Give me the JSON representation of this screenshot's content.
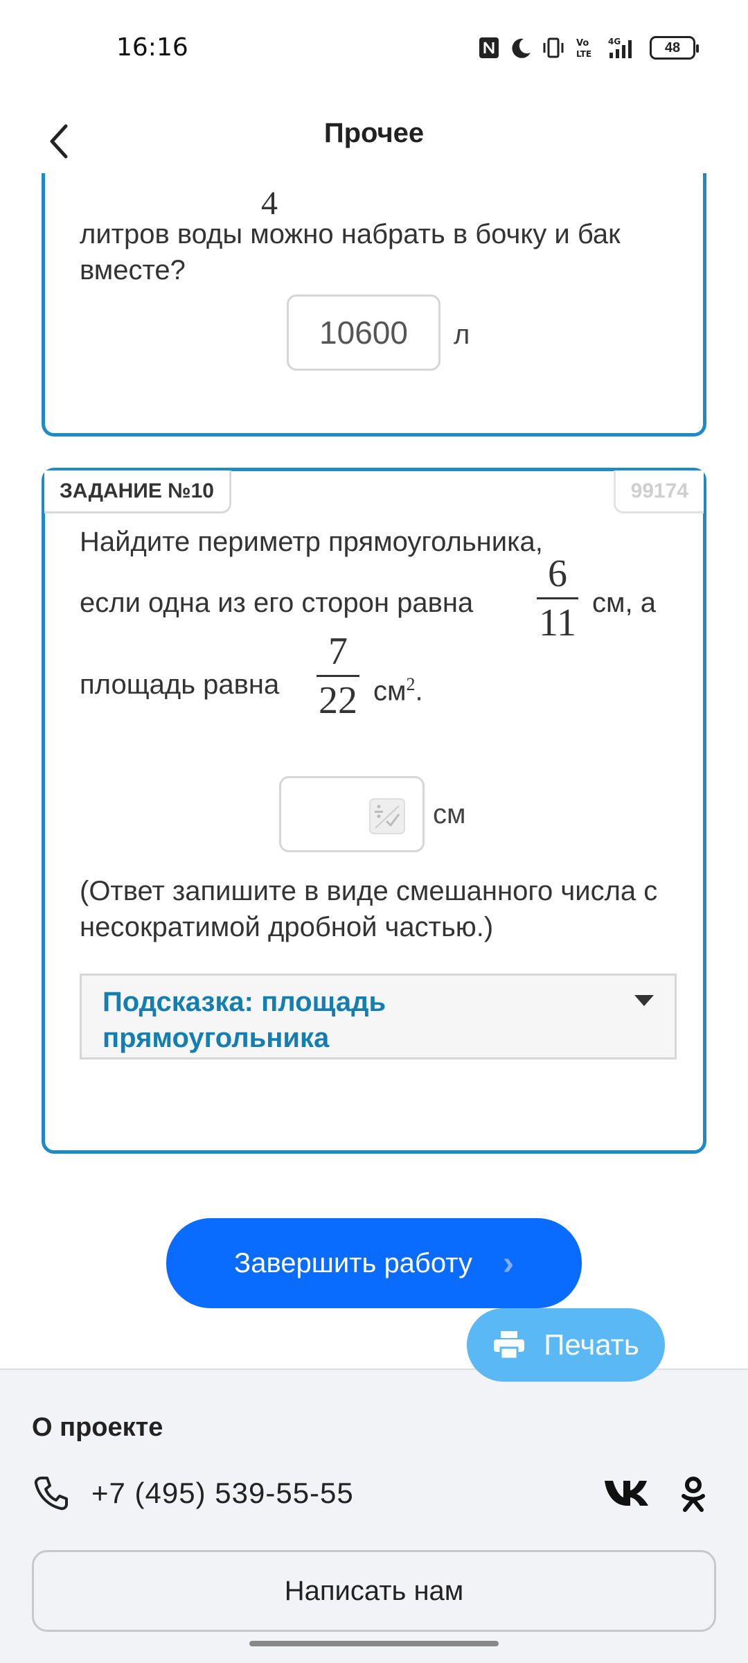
{
  "status_bar": {
    "time": "16:16",
    "battery": "48",
    "icons": [
      "nfc-icon",
      "moon-icon",
      "vibrate-icon",
      "volte-icon",
      "signal-4g-icon",
      "battery-icon"
    ]
  },
  "header": {
    "title": "Прочее",
    "back_icon": "chevron-left-icon"
  },
  "prev_task": {
    "fraction_denominator": "4",
    "text": "литров воды можно набрать в бочку и бак вместе?",
    "answer_value": "10600",
    "unit": "л"
  },
  "task10": {
    "label": "ЗАДАНИЕ №10",
    "id": "99174",
    "line1": "Найдите периметр прямоугольника,",
    "line2_text": "если одна из его сторон равна",
    "frac1": {
      "num": "6",
      "den": "11"
    },
    "line2_suffix": "см, а",
    "line3_text": "площадь равна",
    "frac2": {
      "num": "7",
      "den": "22"
    },
    "line3_suffix": "см",
    "line3_sup": "2",
    "line3_end": ".",
    "answer_value": "",
    "answer_icon": "fraction-input-icon",
    "answer_unit": "см",
    "note": "(Ответ запишите в виде смешанного числа с несократимой дробной частью.)",
    "hint": "Подсказка: площадь прямоугольника",
    "hint_icon": "caret-down-icon"
  },
  "actions": {
    "finish_label": "Завершить работу",
    "finish_arrow": "›",
    "print_label": "Печать",
    "print_icon": "printer-icon"
  },
  "footer": {
    "title": "О проекте",
    "phone": "+7 (495) 539-55-55",
    "phone_icon": "phone-icon",
    "social_icons": [
      "vk-icon",
      "odnoklassniki-icon"
    ],
    "write_label": "Написать нам"
  }
}
